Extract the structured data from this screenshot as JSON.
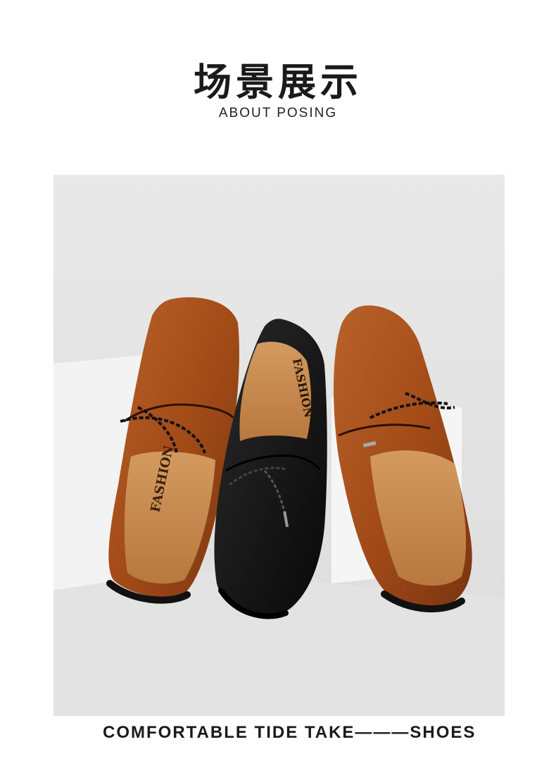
{
  "header": {
    "title": "场景展示",
    "subtitle": "ABOUT POSING"
  },
  "photo": {
    "insole_brand": "FASHION",
    "colors": {
      "background": "#e7e7e7",
      "block": "#f4f4f4",
      "brown_leather": "#a8501c",
      "black_leather": "#141414",
      "insole": "#c88a4c"
    }
  },
  "footer": {
    "tagline": "COMFORTABLE TIDE TAKE———SHOES"
  }
}
